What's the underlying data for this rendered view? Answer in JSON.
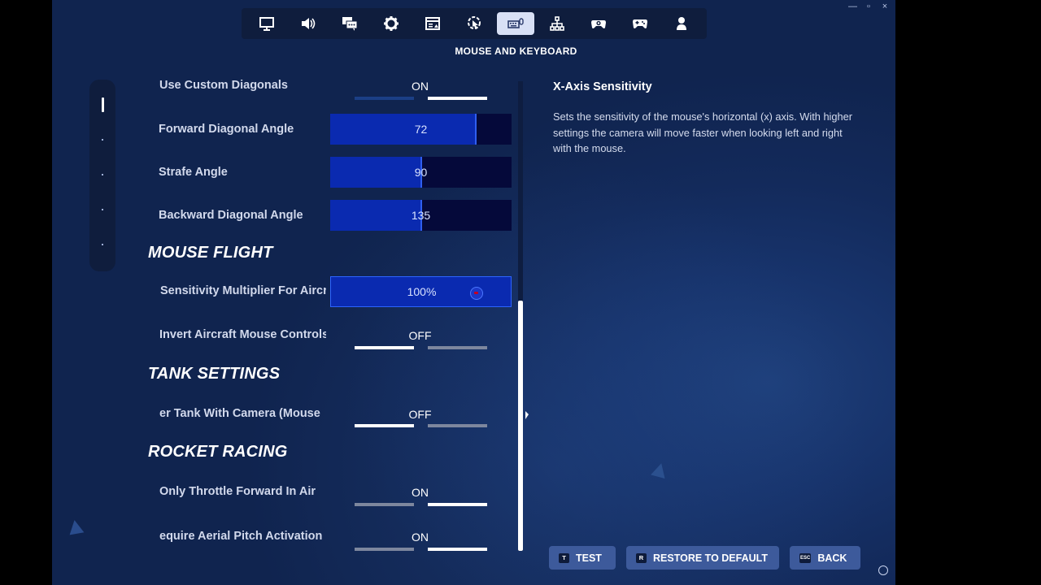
{
  "window": {
    "minimize": "—",
    "maximize": "▫",
    "close": "×"
  },
  "page_title": "MOUSE AND KEYBOARD",
  "nav_tabs": [
    {
      "icon": "monitor-icon"
    },
    {
      "icon": "speaker-icon"
    },
    {
      "icon": "chat-icon"
    },
    {
      "icon": "gear-icon"
    },
    {
      "icon": "ui-layout-icon"
    },
    {
      "icon": "touch-controls-icon"
    },
    {
      "icon": "keyboard-mouse-icon",
      "active": true
    },
    {
      "icon": "network-icon"
    },
    {
      "icon": "controller-settings-icon"
    },
    {
      "icon": "gamepad-icon"
    },
    {
      "icon": "account-icon"
    }
  ],
  "settings": {
    "use_custom_diagonals": {
      "label": "Use Custom Diagonals",
      "value": "ON"
    },
    "forward_diagonal_angle": {
      "label": "Forward Diagonal Angle",
      "value": "72",
      "fill_fraction": 0.81
    },
    "strafe_angle": {
      "label": "Strafe Angle",
      "value": "90",
      "fill_fraction": 0.5
    },
    "backward_diagonal_angle": {
      "label": "Backward Diagonal Angle",
      "value": "135",
      "fill_fraction": 0.5
    },
    "mouse_flight_heading": "MOUSE FLIGHT",
    "sensitivity_multiplier_air": {
      "label": "Sensitivity Multiplier For Aircraft",
      "value": "100%",
      "fill_fraction": 1.0
    },
    "invert_aircraft_mouse": {
      "label": "Invert Aircraft Mouse Controls",
      "value": "OFF"
    },
    "tank_heading": "TANK SETTINGS",
    "tank_with_camera": {
      "label": "er Tank With Camera (Mouse",
      "value": "OFF"
    },
    "rocket_heading": "ROCKET RACING",
    "only_throttle_forward": {
      "label": "Only Throttle Forward In Air",
      "value": "ON"
    },
    "require_aerial_pitch": {
      "label": "equire Aerial Pitch Activation",
      "value": "ON"
    }
  },
  "description": {
    "title": "X-Axis Sensitivity",
    "text": "Sets the sensitivity of the mouse's horizontal (x) axis. With higher settings the camera will move faster when looking left and right with the mouse."
  },
  "footer": {
    "test": {
      "key": "T",
      "label": "TEST"
    },
    "restore": {
      "key": "R",
      "label": "RESTORE TO DEFAULT"
    },
    "back": {
      "key": "ESC",
      "label": "BACK"
    }
  },
  "colors": {
    "accent": "#0a2ab0",
    "toggle_on": "#ffffff",
    "toggle_off": "#7d879e",
    "toggle_off_blue": "#1b3f86"
  }
}
